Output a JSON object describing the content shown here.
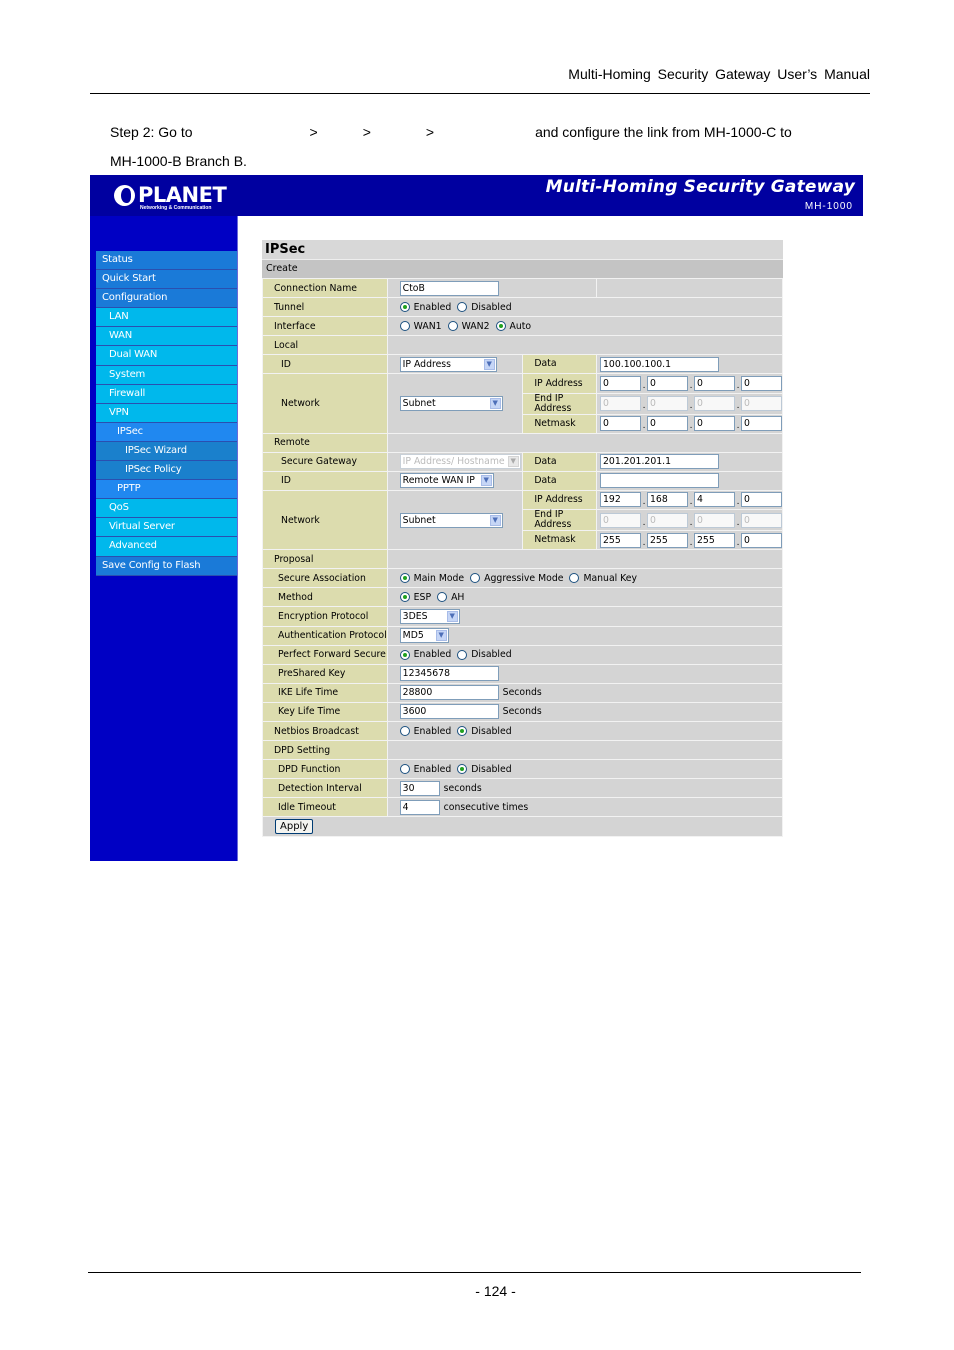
{
  "document": {
    "header": "Multi-Homing Security Gateway User’s Manual",
    "step_prefix": "Step 2: Go to",
    "step_separators": [
      ">",
      ">",
      ">"
    ],
    "step_suffix": "and configure the link from MH-1000-C to",
    "step_line2": "MH-1000-B Branch B.",
    "page_number": "- 124 -"
  },
  "banner": {
    "logo_text": "PLANET",
    "logo_subtext": "Networking & Communication",
    "title": "Multi-Homing Security Gateway",
    "model": "MH-1000"
  },
  "sidebar": {
    "items": [
      {
        "label": "Status",
        "level": 0
      },
      {
        "label": "Quick Start",
        "level": 0
      },
      {
        "label": "Configuration",
        "level": 0
      },
      {
        "label": "LAN",
        "level": 1
      },
      {
        "label": "WAN",
        "level": 1
      },
      {
        "label": "Dual WAN",
        "level": 1
      },
      {
        "label": "System",
        "level": 1
      },
      {
        "label": "Firewall",
        "level": 1
      },
      {
        "label": "VPN",
        "level": 1
      },
      {
        "label": "IPSec",
        "level": 2
      },
      {
        "label": "IPSec Wizard",
        "level": 3
      },
      {
        "label": "IPSec Policy",
        "level": 3
      },
      {
        "label": "PPTP",
        "level": 2
      },
      {
        "label": "QoS",
        "level": 1
      },
      {
        "label": "Virtual Server",
        "level": 1
      },
      {
        "label": "Advanced",
        "level": 1
      },
      {
        "label": "Save Config to Flash",
        "level": 0
      }
    ]
  },
  "form": {
    "title": "IPSec",
    "subtitle": "Create",
    "connection_name": {
      "label": "Connection Name",
      "value": "CtoB"
    },
    "tunnel": {
      "label": "Tunnel",
      "options": [
        "Enabled",
        "Disabled"
      ],
      "selected": "Enabled"
    },
    "interface": {
      "label": "Interface",
      "options": [
        "WAN1",
        "WAN2",
        "Auto"
      ],
      "selected": "Auto"
    },
    "local": {
      "section_label": "Local",
      "id_label": "ID",
      "id_type": "IP Address",
      "data_label": "Data",
      "data_value": "100.100.100.1",
      "network_label": "Network",
      "network_type": "Subnet",
      "ip_label": "IP Address",
      "ip": [
        "0",
        "0",
        "0",
        "0"
      ],
      "end_ip_label": "End IP Address",
      "end_ip": [
        "0",
        "0",
        "0",
        "0"
      ],
      "netmask_label": "Netmask",
      "netmask": [
        "0",
        "0",
        "0",
        "0"
      ]
    },
    "remote": {
      "section_label": "Remote",
      "gateway_label": "Secure Gateway",
      "gateway_type": "IP Address/ Hostname",
      "gateway_data_label": "Data",
      "gateway_data": "201.201.201.1",
      "id_label": "ID",
      "id_type": "Remote WAN IP",
      "id_data_label": "Data",
      "id_data": "",
      "network_label": "Network",
      "network_type": "Subnet",
      "ip_label": "IP Address",
      "ip": [
        "192",
        "168",
        "4",
        "0"
      ],
      "end_ip_label": "End IP Address",
      "end_ip": [
        "0",
        "0",
        "0",
        "0"
      ],
      "netmask_label": "Netmask",
      "netmask": [
        "255",
        "255",
        "255",
        "0"
      ]
    },
    "proposal": {
      "section_label": "Proposal",
      "sa": {
        "label": "Secure Association",
        "options": [
          "Main Mode",
          "Aggressive Mode",
          "Manual Key"
        ],
        "selected": "Main Mode"
      },
      "method": {
        "label": "Method",
        "options": [
          "ESP",
          "AH"
        ],
        "selected": "ESP"
      },
      "encryption": {
        "label": "Encryption Protocol",
        "value": "3DES"
      },
      "authentication": {
        "label": "Authentication Protocol",
        "value": "MD5"
      },
      "pfs": {
        "label": "Perfect Forward Secure",
        "options": [
          "Enabled",
          "Disabled"
        ],
        "selected": "Enabled"
      },
      "psk": {
        "label": "PreShared Key",
        "value": "12345678"
      },
      "ike_life": {
        "label": "IKE Life Time",
        "value": "28800",
        "unit": "Seconds"
      },
      "key_life": {
        "label": "Key Life Time",
        "value": "3600",
        "unit": "Seconds"
      }
    },
    "netbios": {
      "label": "Netbios Broadcast",
      "options": [
        "Enabled",
        "Disabled"
      ],
      "selected": "Disabled"
    },
    "dpd": {
      "section_label": "DPD Setting",
      "function": {
        "label": "DPD Function",
        "options": [
          "Enabled",
          "Disabled"
        ],
        "selected": "Disabled"
      },
      "interval": {
        "label": "Detection Interval",
        "value": "30",
        "unit": "seconds"
      },
      "idle": {
        "label": "Idle Timeout",
        "value": "4",
        "unit": "consecutive times"
      }
    },
    "apply_label": "Apply"
  }
}
